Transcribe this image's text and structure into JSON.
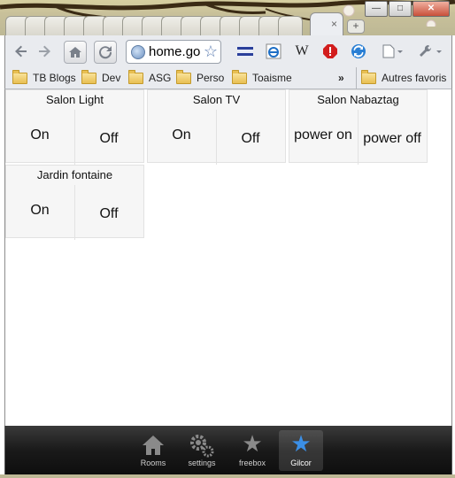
{
  "browser": {
    "url": "home.go",
    "new_tab_glyph": "+",
    "close_tab_glyph": "×",
    "window_controls": [
      "minimize",
      "maximize",
      "close"
    ]
  },
  "toolbar": {
    "back_icon": "back-arrow-icon",
    "forward_icon": "forward-arrow-icon",
    "home_icon": "home-icon",
    "reload_icon": "reload-icon",
    "bookmark_star_icon": "star-icon",
    "extensions": [
      "flag-icon",
      "ie-tab-icon",
      "wikipedia-icon",
      "stop-icon",
      "sync-icon"
    ],
    "wikipedia_letter": "W",
    "page_menu_icon": "page-menu-icon",
    "wrench_menu_icon": "wrench-icon"
  },
  "bookmarks": {
    "items": [
      "TB Blogs",
      "Dev",
      "ASG",
      "Perso",
      "Toaisme"
    ],
    "overflow": "»",
    "other": "Autres favoris"
  },
  "devices": [
    {
      "name": "Salon Light",
      "on": "On",
      "off": "Off"
    },
    {
      "name": "Salon TV",
      "on": "On",
      "off": "Off"
    },
    {
      "name": "Salon Nabaztag",
      "on": "power on",
      "off": "power off"
    },
    {
      "name": "Jardin fontaine",
      "on": "On",
      "off": "Off"
    }
  ],
  "nav": {
    "tabs": [
      {
        "label": "Rooms",
        "icon": "house-icon"
      },
      {
        "label": "settings",
        "icon": "gears-icon"
      },
      {
        "label": "freebox",
        "icon": "star-icon"
      },
      {
        "label": "Gilcor",
        "icon": "star-icon",
        "active": true
      }
    ]
  },
  "colors": {
    "active_nav_icon": "#3b8fe6",
    "frame": "#c8c09a"
  }
}
